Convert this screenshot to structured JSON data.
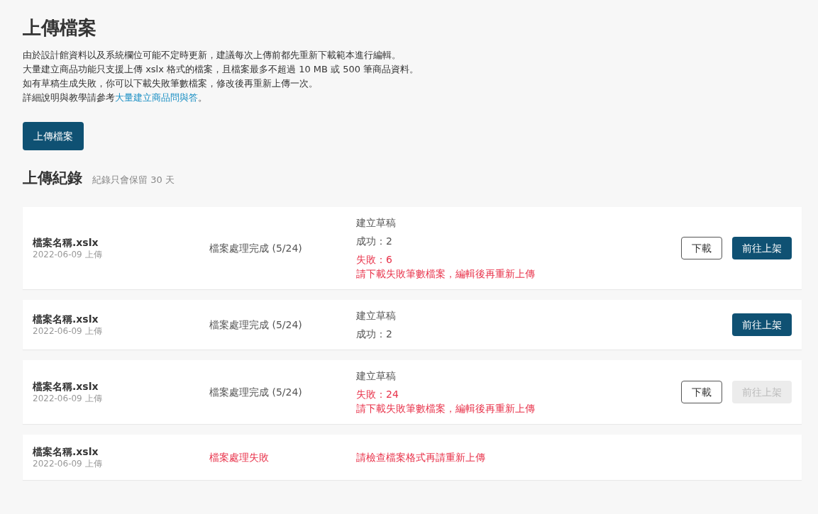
{
  "title": "上傳檔案",
  "intro": {
    "lines": [
      "由於設計館資料以及系統欄位可能不定時更新，建議每次上傳前都先重新下載範本進行編輯。",
      "大量建立商品功能只支援上傳 xslx 格式的檔案，且檔案最多不超過 10 MB 或 500 筆商品資料。",
      "如有草稿生成失敗，你可以下載失敗筆數檔案，修改後再重新上傳一次。"
    ],
    "help": {
      "text": "詳細說明與教學請參考",
      "link": "大量建立商品問與答",
      "after": "。"
    }
  },
  "upload_button": "上傳檔案",
  "history": {
    "title": "上傳紀錄",
    "note": "紀錄只會保留 30 天"
  },
  "records": [
    {
      "file_name": "檔案名稱.xslx",
      "uploaded": "2022-06-09 上傳",
      "status": {
        "text": "檔案處理完成 (5/24)",
        "kind": "ok"
      },
      "results": [
        {
          "text": "建立草稿",
          "kind": "normal"
        },
        {
          "text": "成功：2",
          "kind": "normal"
        },
        {
          "text": "失敗：6",
          "kind": "error"
        },
        {
          "text": "請下載失敗筆數檔案，編輯後再重新上傳",
          "kind": "error"
        }
      ],
      "download": "下載",
      "publish": {
        "label": "前往上架",
        "disabled": false
      }
    },
    {
      "file_name": "檔案名稱.xslx",
      "uploaded": "2022-06-09 上傳",
      "status": {
        "text": "檔案處理完成 (5/24)",
        "kind": "ok"
      },
      "results": [
        {
          "text": "建立草稿",
          "kind": "normal"
        },
        {
          "text": "成功：2",
          "kind": "normal"
        }
      ],
      "publish": {
        "label": "前往上架",
        "disabled": false
      }
    },
    {
      "file_name": "檔案名稱.xslx",
      "uploaded": "2022-06-09 上傳",
      "status": {
        "text": "檔案處理完成 (5/24)",
        "kind": "ok"
      },
      "results": [
        {
          "text": "建立草稿",
          "kind": "normal"
        },
        {
          "text": "失敗：24",
          "kind": "error"
        },
        {
          "text": "請下載失敗筆數檔案，編輯後再重新上傳",
          "kind": "error"
        }
      ],
      "download": "下載",
      "publish": {
        "label": "前往上架",
        "disabled": true
      }
    },
    {
      "file_name": "檔案名稱.xslx",
      "uploaded": "2022-06-09 上傳",
      "status": {
        "text": "檔案處理失敗",
        "kind": "error"
      },
      "results": [
        {
          "text": "請檢查檔案格式再請重新上傳",
          "kind": "error"
        }
      ]
    }
  ]
}
